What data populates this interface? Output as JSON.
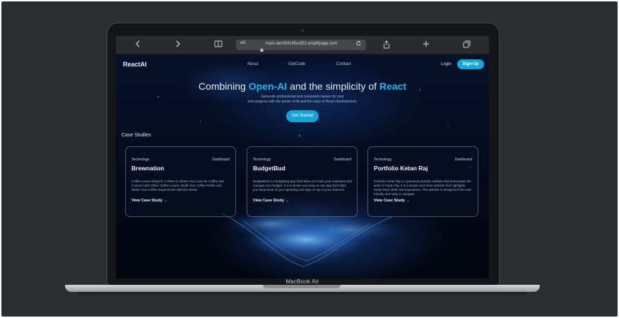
{
  "device": {
    "label": "MacBook Air"
  },
  "browser": {
    "url_prefix": "aA",
    "url": "main.dem5rfc45ui333.amplifyapp.com",
    "icons": {
      "back": "chevron-left-icon",
      "forward": "chevron-right-icon",
      "reader": "book-icon",
      "lock": "lock-icon",
      "reload": "reload-icon",
      "share": "share-icon",
      "new_tab": "plus-icon",
      "tabs": "tabs-icon"
    }
  },
  "nav": {
    "logo": "ReactAI",
    "links": [
      "About",
      "GetCode",
      "Contact"
    ],
    "login": "Login",
    "signup": "Sign-Up"
  },
  "hero": {
    "title_pre": "Combining ",
    "title_accent1": "Open-AI",
    "title_mid": " and the simplicity of ",
    "title_accent2": "React",
    "sub_line1": "Generate professional and consistent names for your",
    "sub_line2": "web projects with the power of AI and the ease of React development.",
    "cta": "Get Started"
  },
  "section": {
    "title": "Case Studies"
  },
  "cards": [
    {
      "tag": "Technology",
      "type": "Dashboard",
      "title": "Brewnation",
      "desc": "Coffee Lovers Rejoice! A Place to Share Your Love for Coffee and Connect with Other Coffee Lovers. Build Your Coffee Profile and Share Your Coffee Experiences with the World.",
      "link": "View Case Study →"
    },
    {
      "tag": "Technology",
      "type": "Dashboard",
      "title": "BudgetBud",
      "desc": "BudgetBud is a budgeting app that helps you track your expenses and manage your budget. It is a simple and easy-to-use app that helps you keep track of your spending and stay on top of your finances.",
      "link": "View Case Study →"
    },
    {
      "tag": "Technology",
      "type": "Dashboard",
      "title": "Portfolio Ketan Raj",
      "desc": "Portfolio Ketan Raj is a personal portfolio website that showcases the work of Ketan Raj. It is a simple and clean website that highlights Ketan Raj's skills and experience. The website is designed to be user-friendly and easy to navigate.",
      "link": "View Case Study →"
    }
  ],
  "colors": {
    "accent": "#20b5ee",
    "button": "#16a7d8",
    "page_bg": "#040a1a",
    "frame_bg": "#2b2d30"
  }
}
